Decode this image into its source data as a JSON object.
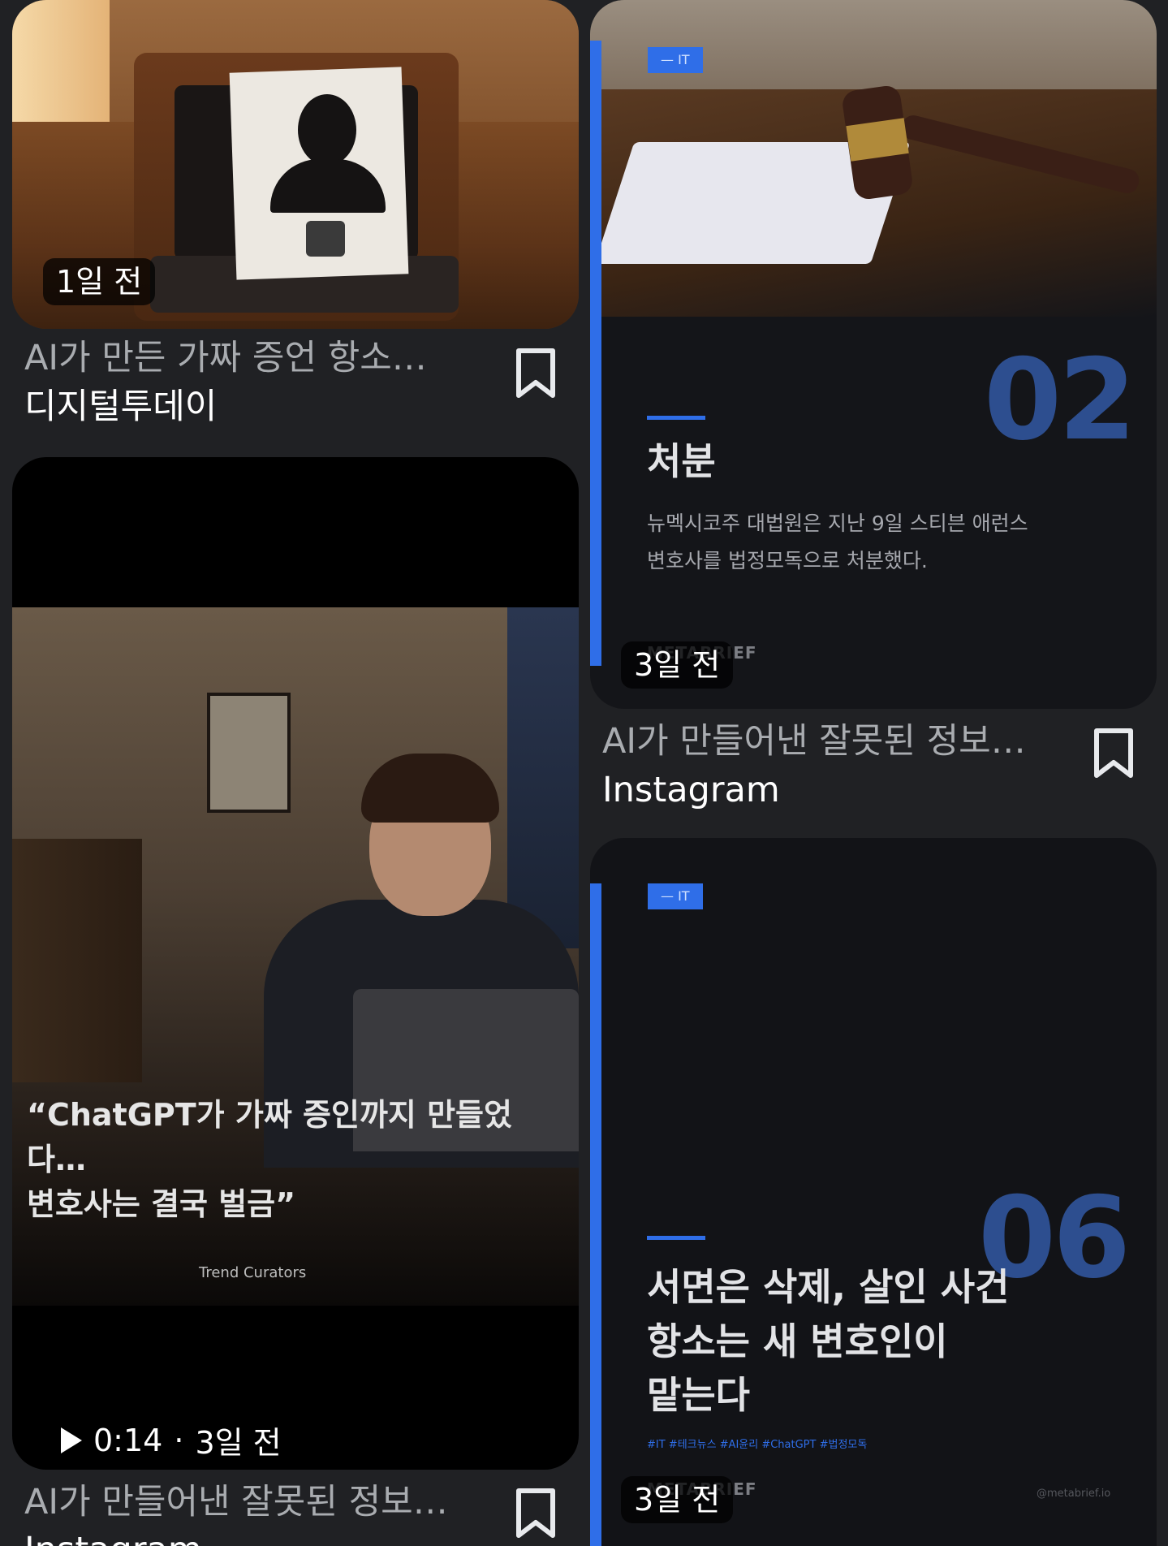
{
  "cards": [
    {
      "meta": "1일 전",
      "title": "AI가 만든 가짜 증언 항소…",
      "source": "디지털투데이"
    },
    {
      "meta": "3일 전",
      "title": "AI가 만들어낸 잘못된 정보…",
      "source": "Instagram",
      "overlay": {
        "number": "02",
        "heading": "처분",
        "body_line1": "뉴멕시코주 대법원은 지난 9일 스티븐 애런스",
        "body_line2": "변호사를 법정모독으로 처분했다.",
        "brand": "METABRIEF"
      }
    },
    {
      "meta_time": "0:14",
      "meta_sep": "·",
      "meta_age": "3일 전",
      "title": "AI가 만들어낸 잘못된 정보…",
      "source": "Instagram",
      "overlay": {
        "quote_line1": "“ChatGPT가 가짜 증인까지 만들었다…",
        "quote_line2": "변호사는 결국 벌금”",
        "credit": "Trend Curators"
      }
    },
    {
      "meta": "3일 전",
      "overlay": {
        "number": "06",
        "heading_line1": "서면은 삭제, 살인 사건",
        "heading_line2": "항소는 새 변호인이",
        "heading_line3": "맡는다",
        "hashtags": "#IT #테크뉴스 #AI윤리 #ChatGPT #법정모독",
        "brand": "METABRIEF",
        "handle": "@metabrief.io"
      }
    }
  ],
  "colors": {
    "background": "#202124",
    "accent_blue": "#2f6ee8",
    "title_gray": "#a9acb0"
  },
  "icons": [
    "bookmark-icon",
    "play-icon"
  ]
}
